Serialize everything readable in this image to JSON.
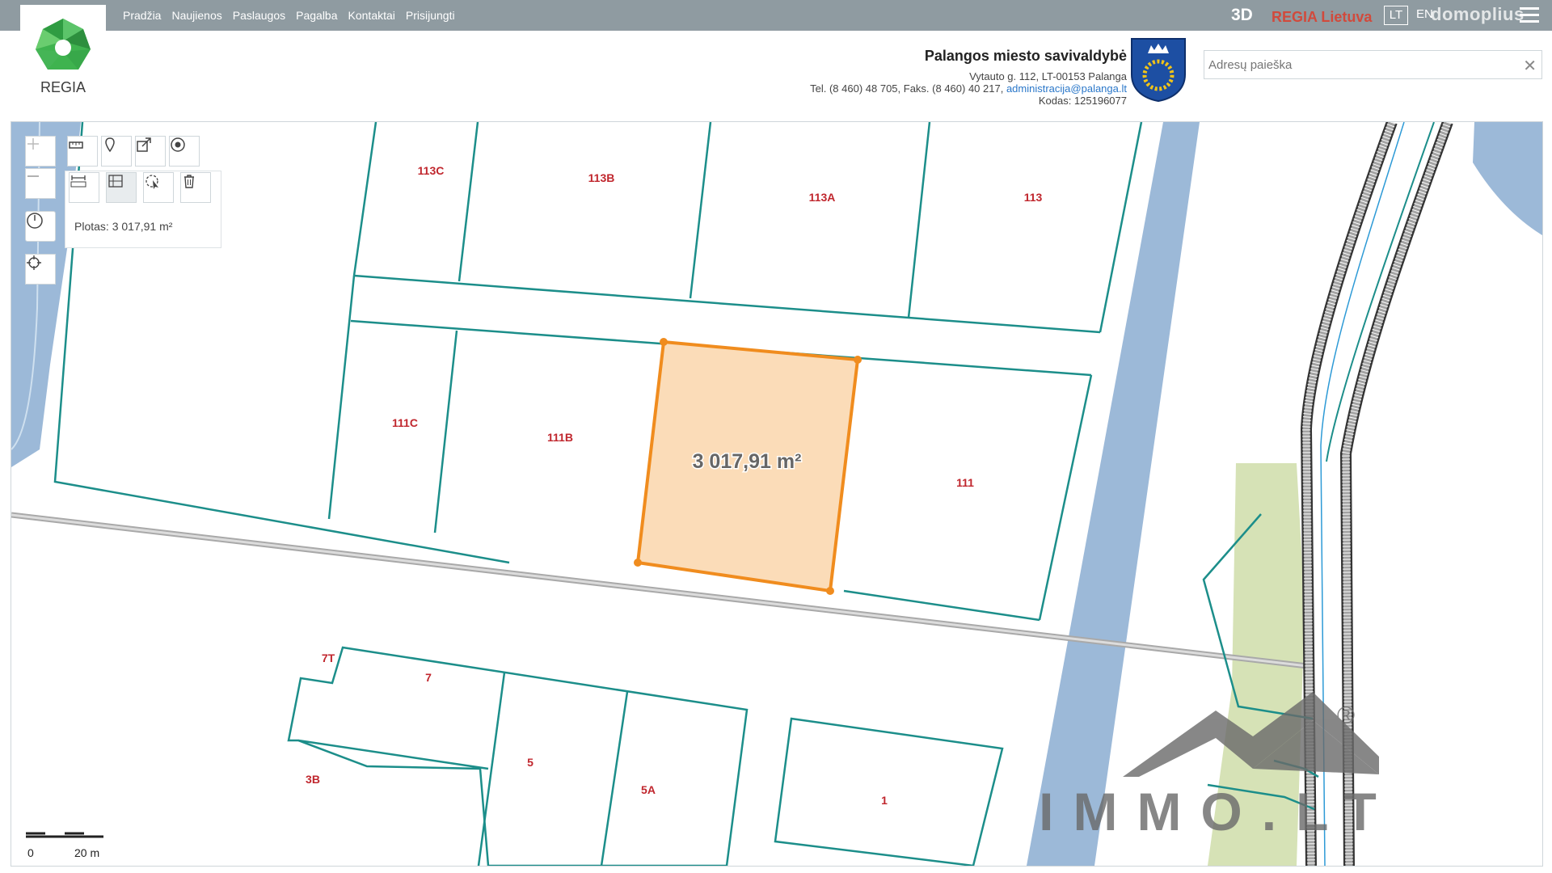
{
  "nav": [
    "Pradžia",
    "Naujienos",
    "Paslaugos",
    "Pagalba",
    "Kontaktai",
    "Prisijungti"
  ],
  "topright": {
    "threed": "3D",
    "regia_lt": "REGIA Lietuva",
    "lang_active": "LT",
    "lang_other": "EN",
    "watermark": "domoplius"
  },
  "logo": {
    "text": "REGIA"
  },
  "municipality": {
    "title": "Palangos miesto savivaldybė",
    "address": "Vytauto g. 112, LT-00153 Palanga",
    "phone": "Tel. (8 460) 48 705, Faks. (8 460) 40 217, ",
    "email": "administracija@palanga.lt",
    "code": "Kodas: 125196077"
  },
  "search": {
    "placeholder": "Adresų paieška"
  },
  "tools": {
    "measure_result": "Plotas: 3 017,91 m²"
  },
  "map": {
    "selected_area_label": "3 017,91 m²",
    "parcels": [
      "113C",
      "113B",
      "113A",
      "113",
      "111C",
      "111B",
      "111",
      "7T",
      "7",
      "5",
      "5A",
      "3B",
      "1"
    ]
  },
  "scale": {
    "start": "0",
    "end": "20 m"
  },
  "watermark": {
    "brand": "IMMO.LT",
    "registered": "®"
  },
  "colors": {
    "parcel_line": "#1c8e8a",
    "parcel_label": "#c0262d",
    "selection_fill": "#fbdcb8",
    "selection_stroke": "#f08c1e",
    "water": "#9cb9d8",
    "green": "#d6e2b6",
    "topbar": "#8f9ba1"
  }
}
